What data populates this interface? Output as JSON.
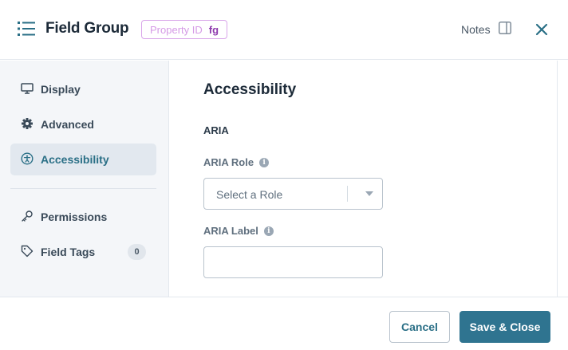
{
  "header": {
    "title": "Field Group",
    "property_label": "Property ID",
    "property_value": "fg",
    "notes_label": "Notes",
    "icon": "list-icon",
    "close_icon": "close-icon"
  },
  "sidebar": {
    "items": [
      {
        "label": "Display",
        "icon": "monitor-icon",
        "active": false
      },
      {
        "label": "Advanced",
        "icon": "gear-icon",
        "active": false
      },
      {
        "label": "Accessibility",
        "icon": "accessibility-icon",
        "active": true
      },
      {
        "label": "Permissions",
        "icon": "key-icon",
        "active": false
      },
      {
        "label": "Field Tags",
        "icon": "tag-icon",
        "active": false,
        "count": "0"
      }
    ]
  },
  "main": {
    "section_title": "Accessibility",
    "subheading": "ARIA",
    "aria_role": {
      "label": "ARIA Role",
      "placeholder": "Select a Role"
    },
    "aria_label": {
      "label": "ARIA Label",
      "value": ""
    }
  },
  "footer": {
    "cancel_label": "Cancel",
    "save_label": "Save & Close"
  },
  "colors": {
    "accent": "#2f7490",
    "active_text": "#2a6f86",
    "badge_border": "#d9a6ea",
    "badge_value": "#8e3aad"
  }
}
